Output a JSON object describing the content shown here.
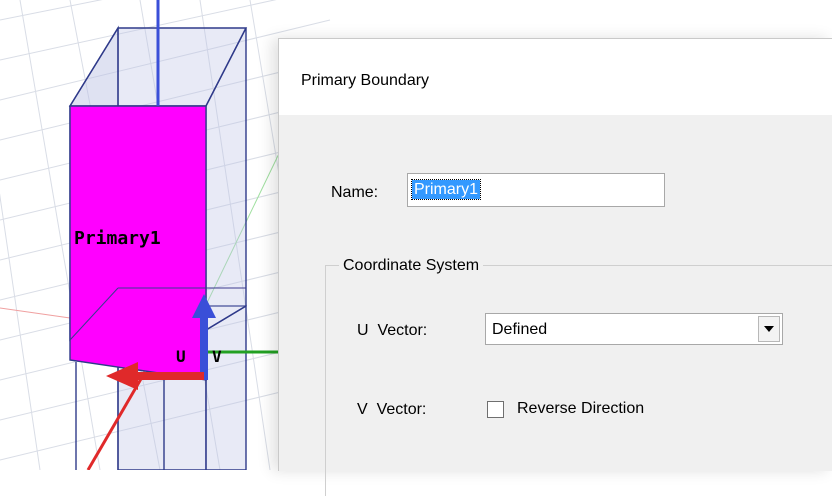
{
  "viewport": {
    "face_label": "Primary1",
    "u_axis_label": "U",
    "v_axis_label": "V",
    "face_color": "#ff00ff"
  },
  "dialog": {
    "title": "Primary Boundary",
    "name_label": "Name:",
    "name_value": "Primary1",
    "coordinate_group_label": "Coordinate System",
    "u_vector_label": "U  Vector:",
    "u_vector_value": "Defined",
    "v_vector_label": "V  Vector:",
    "reverse_direction_label": "Reverse Direction",
    "reverse_direction_checked": false
  }
}
